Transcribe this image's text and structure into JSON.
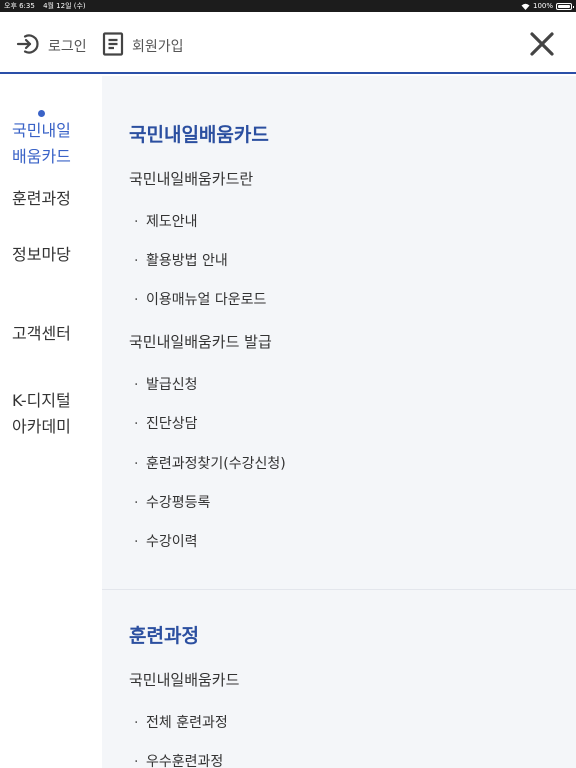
{
  "status": {
    "time": "오후 6:35",
    "date": "4월 12일 (수)",
    "battery": "100%"
  },
  "header": {
    "login_label": "로그인",
    "join_label": "회원가입"
  },
  "sidebar": {
    "items": [
      {
        "label_line1": "국민내일",
        "label_line2": "배움카드",
        "active": true
      },
      {
        "label_line1": "훈련과정"
      },
      {
        "label_line1": "정보마당"
      },
      {
        "label_line1": "고객센터"
      },
      {
        "label_line1": "K-디지털",
        "label_line2": "아카데미"
      }
    ]
  },
  "content": {
    "section1": {
      "title": "국민내일배움카드",
      "groups": [
        {
          "title": "국민내일배움카드란",
          "links": [
            "제도안내",
            "활용방법 안내",
            "이용매뉴얼 다운로드"
          ]
        },
        {
          "title": "국민내일배움카드 발급",
          "links": [
            "발급신청",
            "진단상담",
            "훈련과정찾기(수강신청)",
            "수강평등록",
            "수강이력"
          ]
        }
      ]
    },
    "section2": {
      "title": "훈련과정",
      "groups": [
        {
          "title": "국민내일배움카드",
          "links": [
            "전체 훈련과정",
            "우수훈련과정"
          ]
        }
      ]
    }
  },
  "colors": {
    "accent": "#3a63c7",
    "title": "#2b4fa0",
    "panel": "#f4f6f9"
  }
}
